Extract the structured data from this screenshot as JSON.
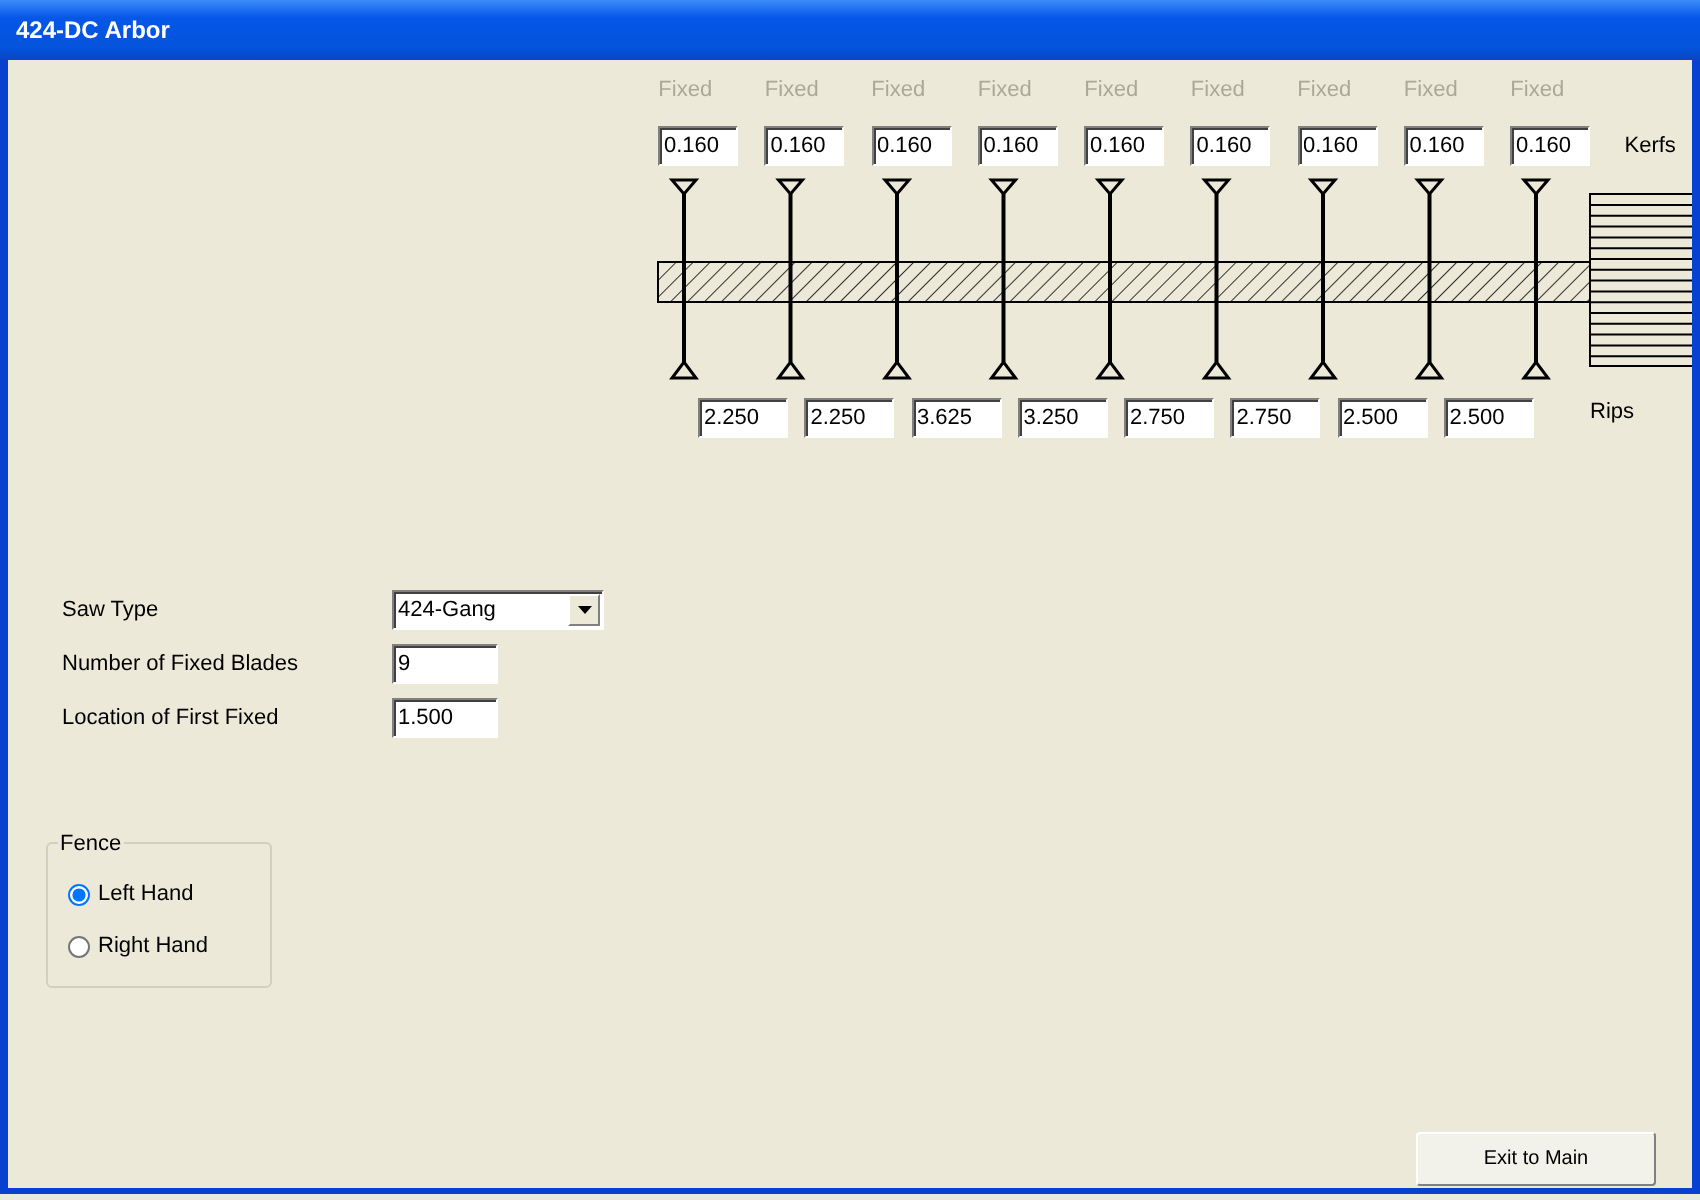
{
  "window": {
    "title": "424-DC Arbor"
  },
  "blades": [
    {
      "label": "Fixed",
      "disabled": true,
      "kerf": "0.160"
    },
    {
      "label": "Fixed",
      "disabled": true,
      "kerf": "0.160"
    },
    {
      "label": "Fixed",
      "disabled": true,
      "kerf": "0.160"
    },
    {
      "label": "Fixed",
      "disabled": true,
      "kerf": "0.160"
    },
    {
      "label": "Fixed",
      "disabled": true,
      "kerf": "0.160"
    },
    {
      "label": "Fixed",
      "disabled": true,
      "kerf": "0.160"
    },
    {
      "label": "Fixed",
      "disabled": true,
      "kerf": "0.160"
    },
    {
      "label": "Fixed",
      "disabled": true,
      "kerf": "0.160"
    },
    {
      "label": "Fixed",
      "disabled": true,
      "kerf": "0.160"
    }
  ],
  "kerfs_label": "Kerfs",
  "rips": [
    "2.250",
    "2.250",
    "3.625",
    "3.250",
    "2.750",
    "2.750",
    "2.500",
    "2.500"
  ],
  "rips_label": "Rips",
  "fields": [
    {
      "kind": "select",
      "label": "Saw Type",
      "value": "424-Gang"
    },
    {
      "kind": "text",
      "label": "Number of Fixed Blades",
      "value": "9"
    },
    {
      "kind": "text",
      "label": "Location of First Fixed",
      "value": "1.500"
    }
  ],
  "fence": {
    "title": "Fence",
    "options": [
      {
        "label": "Left Hand",
        "selected": true
      },
      {
        "label": "Right Hand",
        "selected": false
      }
    ]
  },
  "buttons": [
    {
      "label": "Exit to Main"
    }
  ]
}
